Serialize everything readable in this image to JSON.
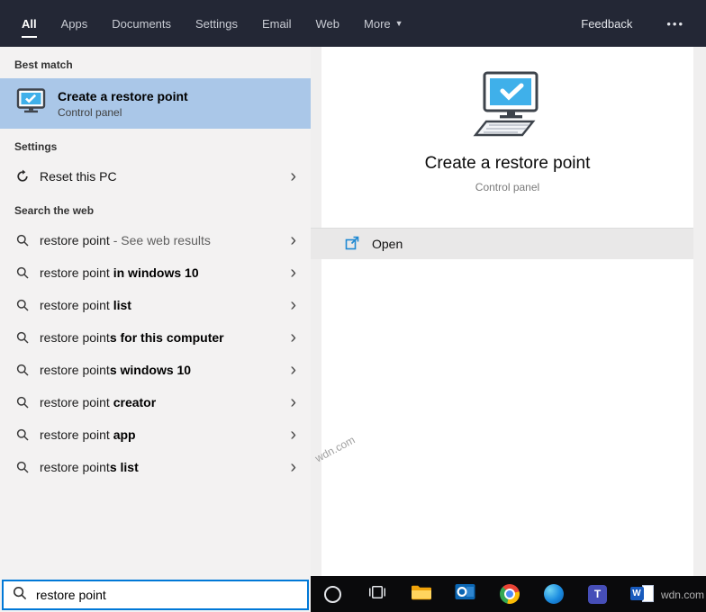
{
  "colors": {
    "accent": "#0078d7",
    "header_bg": "#232735",
    "best_match_highlight": "#aac7e8",
    "left_panel_bg": "#f3f2f2",
    "open_row_bg": "#e9e8e8",
    "taskbar_bg": "#0a0a0c"
  },
  "header": {
    "tabs": [
      "All",
      "Apps",
      "Documents",
      "Settings",
      "Email",
      "Web",
      "More"
    ],
    "feedback": "Feedback",
    "ellipsis": "•••"
  },
  "left": {
    "best_match_header": "Best match",
    "best_match": {
      "title": "Create a restore point",
      "subtitle": "Control panel"
    },
    "settings_header": "Settings",
    "reset_label": "Reset this PC",
    "web_header": "Search the web",
    "suggestions": [
      {
        "typed": "restore point",
        "suffix": "",
        "note": " - See web results"
      },
      {
        "typed": "restore point",
        "suffix": " in windows 10"
      },
      {
        "typed": "restore point",
        "suffix": " list"
      },
      {
        "typed": "restore point",
        "suffix": "s for this computer"
      },
      {
        "typed": "restore point",
        "suffix": "s windows 10"
      },
      {
        "typed": "restore point",
        "suffix": " creator"
      },
      {
        "typed": "restore point",
        "suffix": " app"
      },
      {
        "typed": "restore point",
        "suffix": "s list"
      }
    ],
    "search_value": "restore point"
  },
  "right": {
    "title": "Create a restore point",
    "subtitle": "Control panel",
    "open_label": "Open"
  },
  "taskbar": {
    "icons": [
      "cortana",
      "task-view",
      "file-explorer",
      "outlook",
      "chrome",
      "edge",
      "teams",
      "word"
    ],
    "teams_glyph": "T",
    "word_glyph": "W"
  },
  "watermark": "wdn.com"
}
